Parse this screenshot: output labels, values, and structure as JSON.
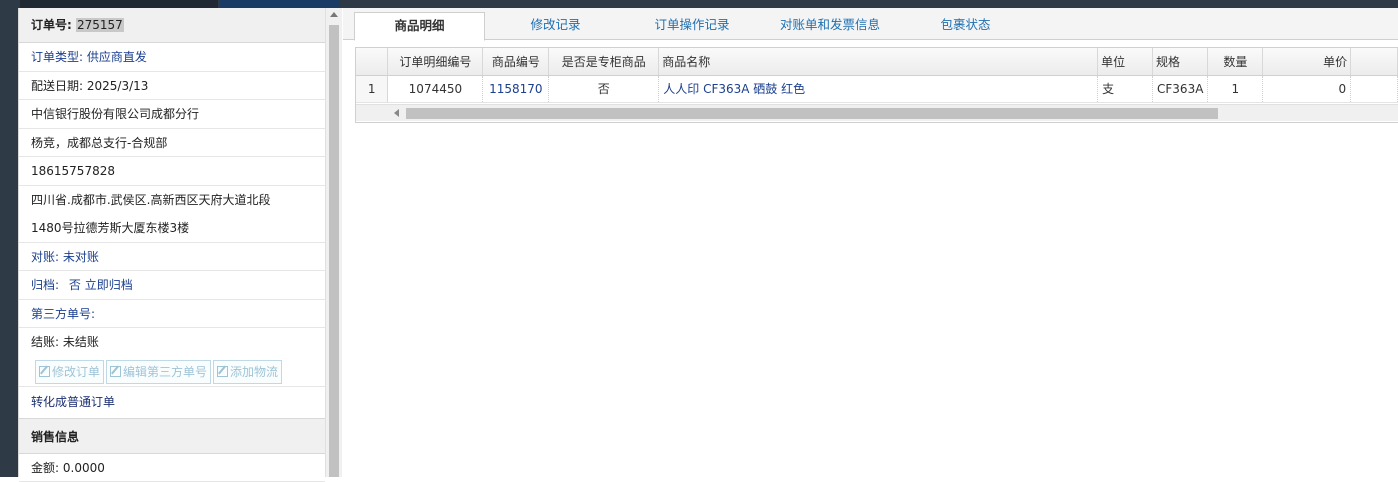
{
  "order": {
    "number_label": "订单号:",
    "number_value": "275157",
    "type_label": "订单类型:",
    "type_value": "供应商直发",
    "delivery_label": "配送日期:",
    "delivery_value": "2025/3/13",
    "company": "中信银行股份有限公司成都分行",
    "contact": "杨竞，成都总支行-合规部",
    "phone": "18615757828",
    "address_line1": "四川省.成都市.武侯区.高新西区天府大道北段",
    "address_line2": "1480号拉德芳斯大厦东楼3楼",
    "reconcile_label": "对账:",
    "reconcile_value": "未对账",
    "archive_label": "归档:",
    "archive_value": "否",
    "archive_action": "立即归档",
    "third_party_label": "第三方单号:",
    "settle_label": "结账:",
    "settle_value": "未结账"
  },
  "actions": {
    "edit_order": "修改订单",
    "edit_third_party": "编辑第三方单号",
    "add_logistics": "添加物流",
    "convert": "转化成普通订单"
  },
  "sales": {
    "section_title": "销售信息",
    "amount_label": "金额:",
    "amount_value": "0.0000"
  },
  "tabs": [
    {
      "label": "商品明细"
    },
    {
      "label": "修改记录"
    },
    {
      "label": "订单操作记录"
    },
    {
      "label": "对账单和发票信息"
    },
    {
      "label": "包裹状态"
    }
  ],
  "grid": {
    "columns": [
      "订单明细编号",
      "商品编号",
      "是否是专柜商品",
      "商品名称",
      "单位",
      "规格",
      "数量",
      "单价"
    ],
    "rows": [
      {
        "rownum": "1",
        "detail_id": "1074450",
        "product_id": "1158170",
        "counter": "否",
        "name": "人人印 CF363A 硒鼓 红色",
        "unit": "支",
        "spec": "CF363A",
        "qty": "1",
        "price": "0"
      }
    ]
  },
  "colors": {
    "accent": "#1b3f8f",
    "tab_link": "#1f6fb0",
    "sidebar_dark": "#2f3a47"
  }
}
